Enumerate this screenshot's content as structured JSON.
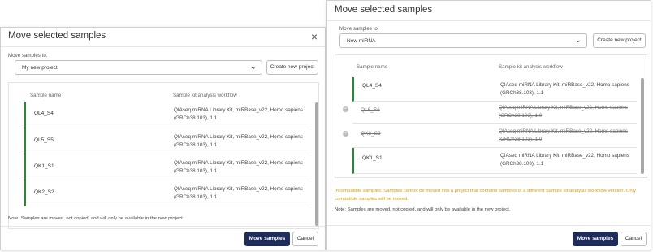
{
  "left_dialog": {
    "title": "Move selected samples",
    "move_to_label": "Move samples to:",
    "project_value": "My new project",
    "create_project_label": "Create new project",
    "col_sample_name": "Sample name",
    "col_workflow": "Sample kit analysis workflow",
    "rows": [
      {
        "name": "QL4_S4",
        "workflow": "QIAseq miRNA Library Kit, miRBase_v22, Homo sapiens (GRCh38.103), 1.1"
      },
      {
        "name": "QL5_S5",
        "workflow": "QIAseq miRNA Library Kit, miRBase_v22, Homo sapiens (GRCh38.103), 1.1"
      },
      {
        "name": "QK1_S1",
        "workflow": "QIAseq miRNA Library Kit, miRBase_v22, Homo sapiens (GRCh38.103), 1.1"
      },
      {
        "name": "QK2_S2",
        "workflow": "QIAseq miRNA Library Kit, miRBase_v22, Homo sapiens (GRCh38.103), 1.1"
      }
    ],
    "note": "Note: Samples are moved, not copied, and will only be available in the new project.",
    "primary_label": "Move samples",
    "cancel_label": "Cancel"
  },
  "right_dialog": {
    "title": "Move selected samples",
    "move_to_label": "Move samples to:",
    "project_value": "New miRNA",
    "create_project_label": "Create new project",
    "col_sample_name": "Sample name",
    "col_workflow": "Sample kit analysis workflow",
    "rows": [
      {
        "name": "QL4_S4",
        "workflow": "QIAseq miRNA Library Kit, miRBase_v22, Homo sapiens (GRCh38.103), 1.1",
        "status": "ok"
      },
      {
        "name": "QL6_S6",
        "workflow": "QIAseq miRNA Library Kit, miRBase_v22, Homo sapiens (GRCh38.103), 1.0",
        "status": "incompatible"
      },
      {
        "name": "QK3_S3",
        "workflow": "QIAseq miRNA Library Kit, miRBase_v22, Homo sapiens (GRCh38.103), 1.0",
        "status": "incompatible"
      },
      {
        "name": "QK1_S1",
        "workflow": "QIAseq miRNA Library Kit, miRBase_v22, Homo sapiens (GRCh38.103), 1.1",
        "status": "ok"
      }
    ],
    "warning": "Incompatible samples. Samples cannot be moved into a project that contains samples of a different Sample kit analysis workflow version. Only compatible samples will be moved.",
    "note": "Note: Samples are moved, not copied, and will only be available in the new project.",
    "primary_label": "Move samples",
    "cancel_label": "Cancel"
  },
  "icons": {
    "close": "×",
    "chevron": "⌄",
    "incompatible": "×"
  },
  "colors": {
    "primary": "#1f2d5c",
    "compatible_bar": "#1f8f2a",
    "warning": "#e09b00",
    "incompatible_icon": "#bdbdbd"
  }
}
